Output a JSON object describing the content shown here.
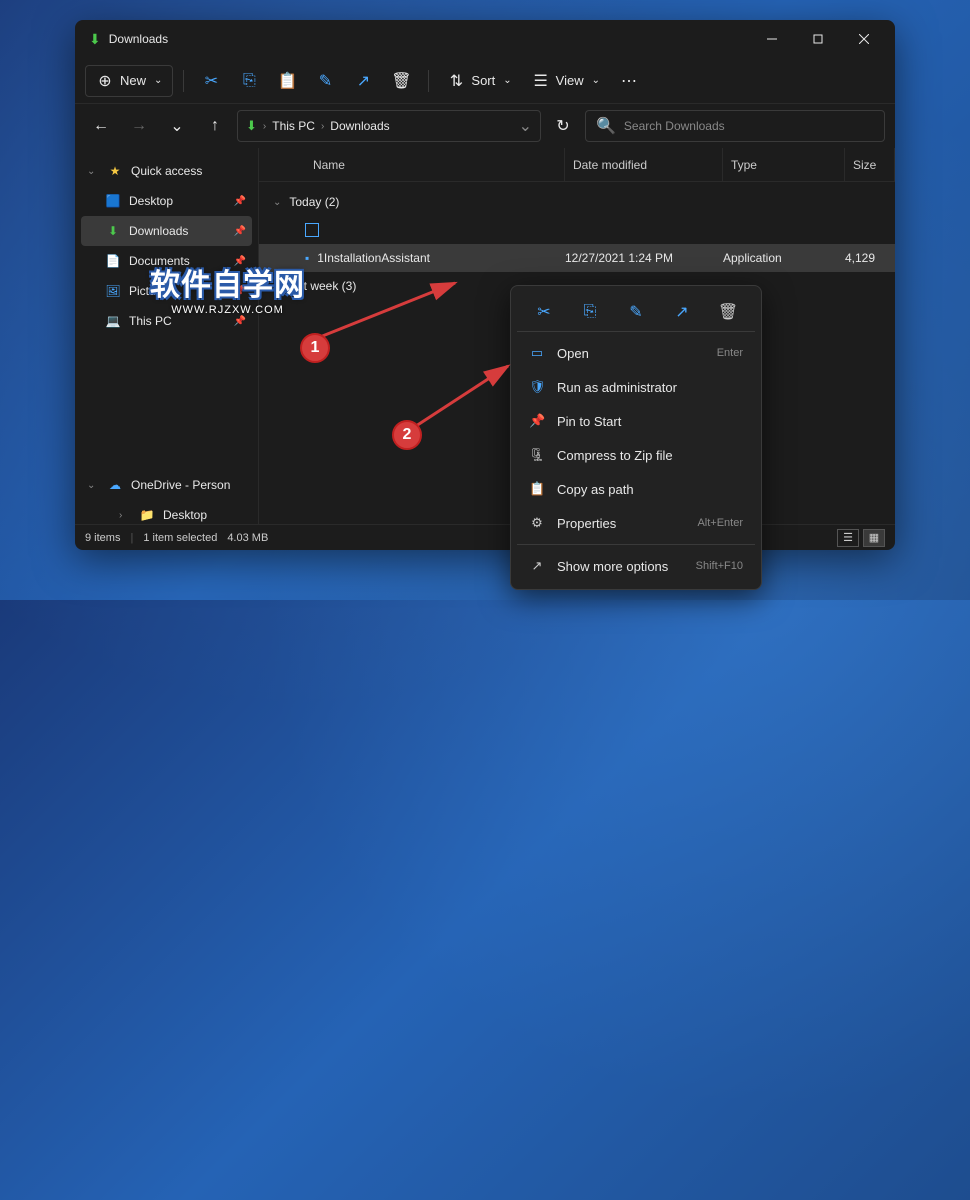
{
  "window": {
    "title": "Downloads"
  },
  "toolbar": {
    "new_label": "New",
    "sort_label": "Sort",
    "view_label": "View"
  },
  "breadcrumb": {
    "items": [
      "This PC",
      "Downloads"
    ]
  },
  "search": {
    "placeholder": "Search Downloads"
  },
  "sidebar": {
    "quick_access": "Quick access",
    "items": [
      {
        "icon": "🟦",
        "label": "Desktop",
        "pinned": true
      },
      {
        "icon": "⬇",
        "label": "Downloads",
        "pinned": true,
        "selected": true,
        "icon_color": "#4cc94c"
      },
      {
        "icon": "📄",
        "label": "Documents",
        "pinned": true
      },
      {
        "icon": "🖼",
        "label": "Pictures",
        "pinned": true
      },
      {
        "icon": "💻",
        "label": "This PC",
        "pinned": true
      }
    ],
    "onedrive": "OneDrive - Person",
    "desktop_sub": "Desktop"
  },
  "columns": {
    "name": "Name",
    "date": "Date modified",
    "type": "Type",
    "size": "Size"
  },
  "groups": [
    {
      "label": "Today (2)",
      "expanded": true,
      "files": [
        {
          "name": "1InstallationAssistant",
          "date": "12/27/2021 1:24 PM",
          "type": "Application",
          "size": "4,129",
          "selected": true
        }
      ]
    },
    {
      "label": "Last week (3)",
      "expanded": false,
      "files": []
    }
  ],
  "statusbar": {
    "items_count": "9 items",
    "selected": "1 item selected",
    "size": "4.03 MB"
  },
  "context_menu": {
    "items": [
      {
        "icon": "▭",
        "label": "Open",
        "shortcut": "Enter"
      },
      {
        "icon": "🛡",
        "label": "Run as administrator",
        "shortcut": ""
      },
      {
        "icon": "📌",
        "label": "Pin to Start",
        "shortcut": ""
      },
      {
        "icon": "🗜",
        "label": "Compress to Zip file",
        "shortcut": ""
      },
      {
        "icon": "📋",
        "label": "Copy as path",
        "shortcut": ""
      },
      {
        "icon": "⚙",
        "label": "Properties",
        "shortcut": "Alt+Enter"
      },
      {
        "icon": "↗",
        "label": "Show more options",
        "shortcut": "Shift+F10"
      }
    ]
  },
  "annotations": {
    "badge1": "1",
    "badge2": "2"
  },
  "watermark": {
    "main": "软件自学网",
    "sub": "WWW.RJZXW.COM"
  }
}
